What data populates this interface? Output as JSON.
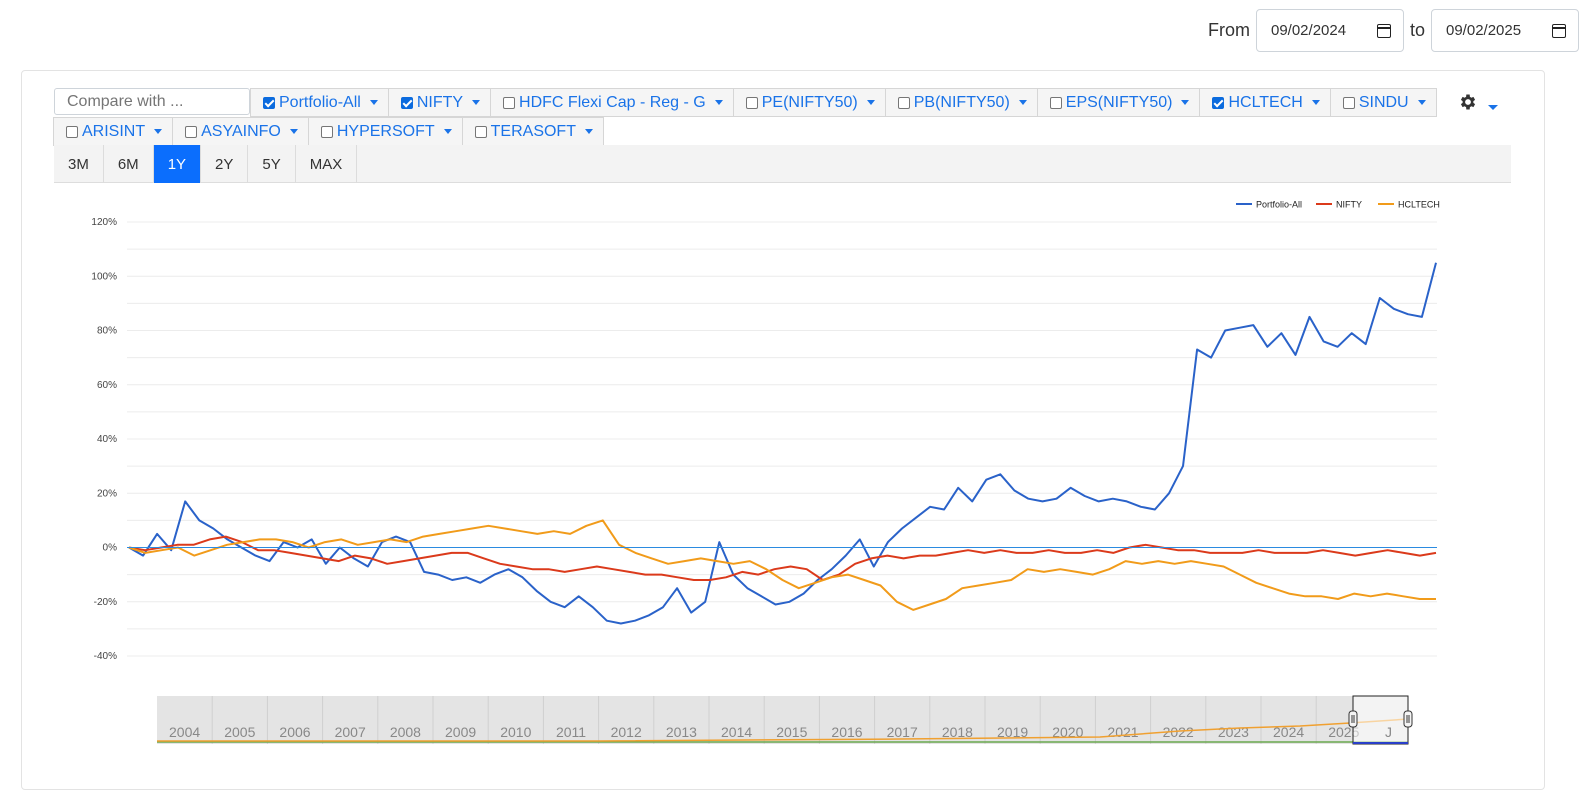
{
  "date_range": {
    "from_label": "From",
    "from_value": "09/02/2024",
    "to_label": "to",
    "to_value": "09/02/2025"
  },
  "compare": {
    "placeholder": "Compare with ..."
  },
  "chips_row1": [
    {
      "label": "Portfolio-All",
      "checked": true
    },
    {
      "label": "NIFTY",
      "checked": true
    },
    {
      "label": "HDFC Flexi Cap - Reg - G",
      "checked": false
    },
    {
      "label": "PE(NIFTY50)",
      "checked": false
    },
    {
      "label": "PB(NIFTY50)",
      "checked": false
    },
    {
      "label": "EPS(NIFTY50)",
      "checked": false
    },
    {
      "label": "HCLTECH",
      "checked": true
    },
    {
      "label": "SINDU",
      "checked": false
    }
  ],
  "chips_row2": [
    {
      "label": "ARISINT",
      "checked": false
    },
    {
      "label": "ASYAINFO",
      "checked": false
    },
    {
      "label": "HYPERSOFT",
      "checked": false
    },
    {
      "label": "TERASOFT",
      "checked": false
    }
  ],
  "range_tabs": [
    {
      "label": "3M",
      "active": false
    },
    {
      "label": "6M",
      "active": false
    },
    {
      "label": "1Y",
      "active": true
    },
    {
      "label": "2Y",
      "active": false
    },
    {
      "label": "5Y",
      "active": false
    },
    {
      "label": "MAX",
      "active": false
    }
  ],
  "icons": {
    "settings": "gear-icon",
    "settings_menu": "chevron-down-icon",
    "date_picker": "calendar-icon"
  },
  "chart_data": {
    "type": "line",
    "ylim": [
      -40,
      120
    ],
    "yticks": [
      -40,
      -20,
      0,
      20,
      40,
      60,
      80,
      100,
      120
    ],
    "ytick_suffix": "%",
    "grid": true,
    "legend": "top-right",
    "x_range": [
      "09/02/2024",
      "09/02/2025"
    ],
    "series": [
      {
        "name": "Portfolio-All",
        "color": "#2a62c9",
        "values": [
          0,
          -3,
          5,
          -1,
          17,
          10,
          7,
          3,
          0,
          -3,
          -5,
          2,
          0,
          3,
          -6,
          0,
          -4,
          -7,
          2,
          4,
          2,
          -9,
          -10,
          -12,
          -11,
          -13,
          -10,
          -8,
          -11,
          -16,
          -20,
          -22,
          -18,
          -22,
          -27,
          -28,
          -27,
          -25,
          -22,
          -15,
          -24,
          -20,
          2,
          -10,
          -15,
          -18,
          -21,
          -20,
          -17,
          -12,
          -8,
          -3,
          3,
          -7,
          2,
          7,
          11,
          15,
          14,
          22,
          17,
          25,
          27,
          21,
          18,
          17,
          18,
          22,
          19,
          17,
          18,
          17,
          15,
          14,
          20,
          30,
          73,
          70,
          80,
          81,
          82,
          74,
          79,
          71,
          85,
          76,
          74,
          79,
          75,
          92,
          88,
          86,
          85,
          105
        ]
      },
      {
        "name": "NIFTY",
        "color": "#db3a1b",
        "values": [
          0,
          -1,
          0,
          1,
          1,
          3,
          4,
          2,
          -1,
          -1,
          -2,
          -3,
          -4,
          -5,
          -3,
          -4,
          -6,
          -5,
          -4,
          -3,
          -2,
          -2,
          -4,
          -6,
          -7,
          -8,
          -8,
          -9,
          -8,
          -7,
          -8,
          -9,
          -10,
          -10,
          -11,
          -12,
          -12,
          -11,
          -9,
          -10,
          -8,
          -7,
          -8,
          -12,
          -10,
          -6,
          -4,
          -3,
          -4,
          -3,
          -3,
          -2,
          -1,
          -2,
          -1,
          -2,
          -2,
          -1,
          -2,
          -2,
          -1,
          -2,
          0,
          1,
          0,
          -1,
          -1,
          -2,
          -2,
          -2,
          -1,
          -2,
          -2,
          -2,
          -1,
          -2,
          -3,
          -2,
          -1,
          -2,
          -3,
          -2
        ]
      },
      {
        "name": "HCLTECH",
        "color": "#f19b1a",
        "values": [
          0,
          -2,
          -1,
          0,
          -3,
          -1,
          1,
          2,
          3,
          3,
          2,
          0,
          2,
          3,
          1,
          2,
          3,
          2,
          4,
          5,
          6,
          7,
          8,
          7,
          6,
          5,
          6,
          5,
          8,
          10,
          1,
          -2,
          -4,
          -6,
          -5,
          -4,
          -5,
          -6,
          -5,
          -8,
          -12,
          -15,
          -13,
          -11,
          -10,
          -12,
          -14,
          -20,
          -23,
          -21,
          -19,
          -15,
          -14,
          -13,
          -12,
          -8,
          -9,
          -8,
          -9,
          -10,
          -8,
          -5,
          -6,
          -5,
          -6,
          -5,
          -6,
          -7,
          -10,
          -13,
          -15,
          -17,
          -18,
          -18,
          -19,
          -17,
          -18,
          -17,
          -18,
          -19,
          -19
        ]
      }
    ],
    "navigator": {
      "years": [
        "2004",
        "2005",
        "2006",
        "2007",
        "2008",
        "2009",
        "2010",
        "2011",
        "2012",
        "2013",
        "2014",
        "2015",
        "2016",
        "2017",
        "2018",
        "2019",
        "2020",
        "2021",
        "2022",
        "2023",
        "2024",
        "2025"
      ],
      "selected_label": "J"
    }
  }
}
